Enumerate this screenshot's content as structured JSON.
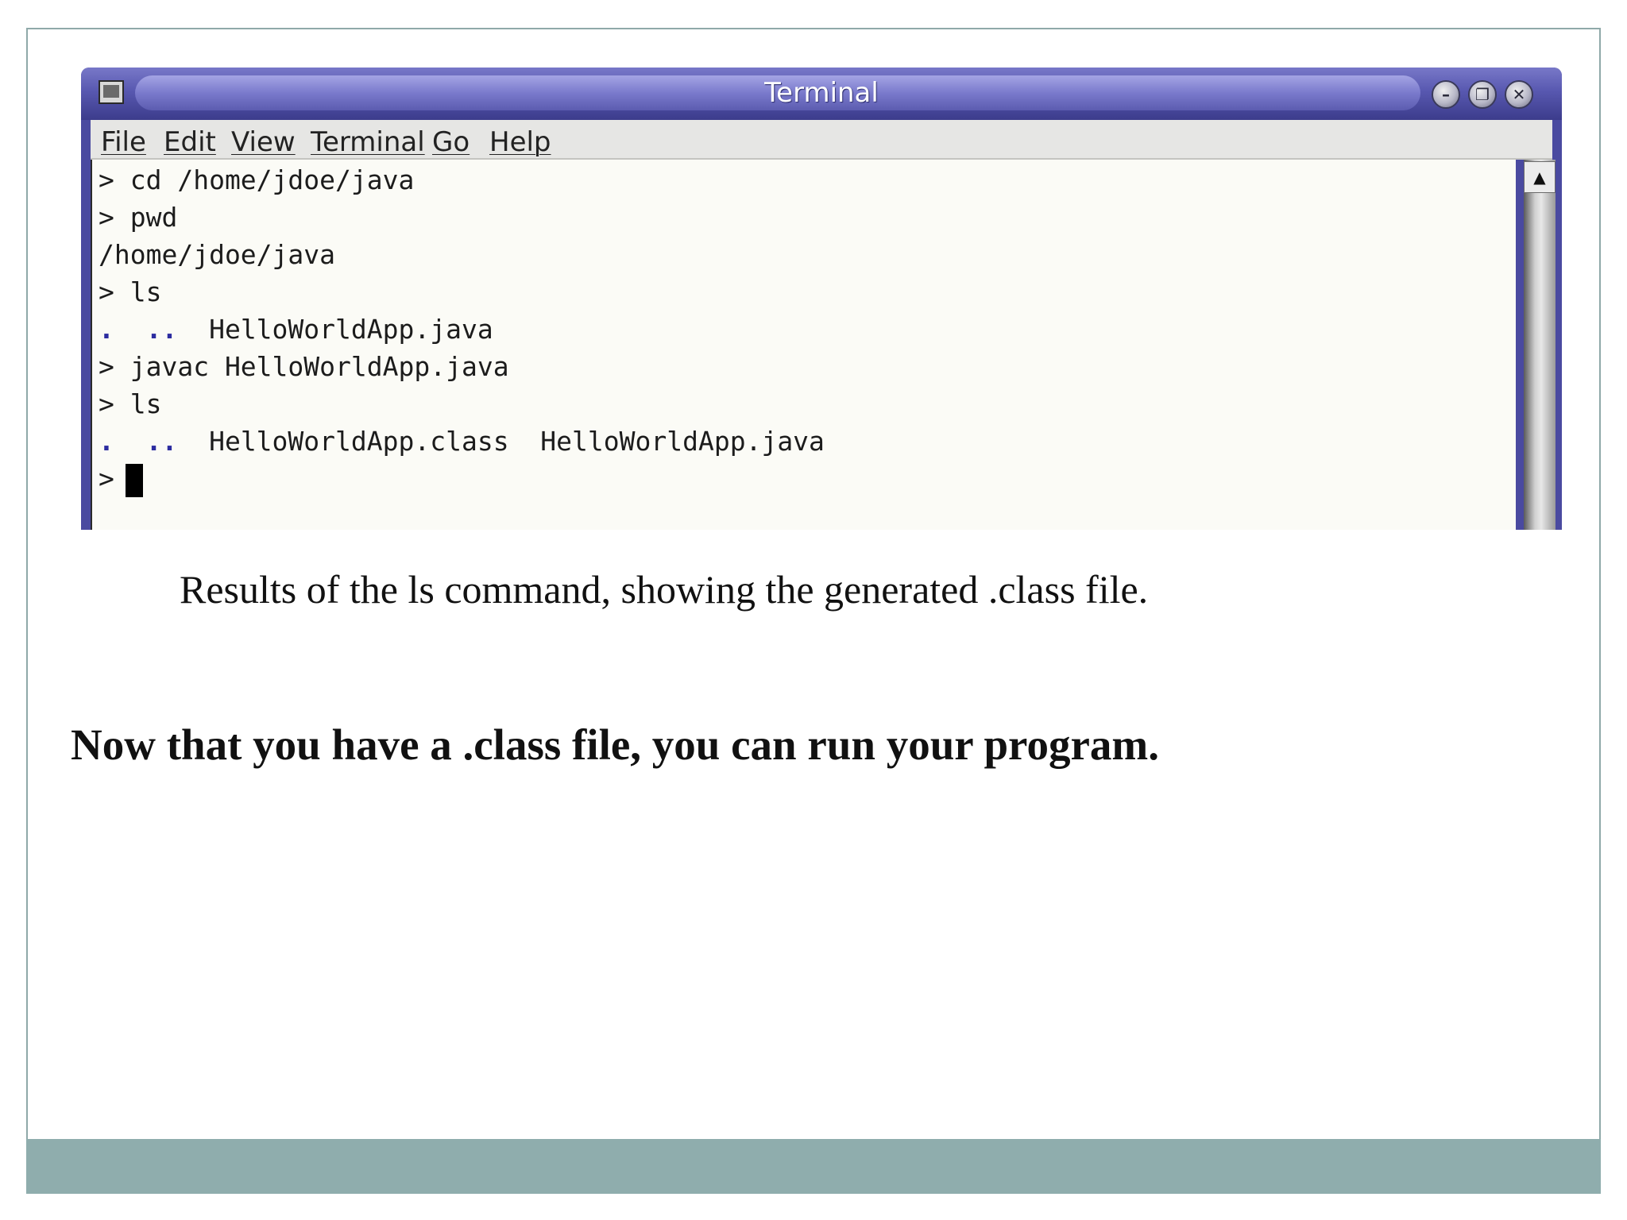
{
  "window": {
    "title": "Terminal",
    "buttons": {
      "minimize": "–",
      "maximize": "❐",
      "close": "✕"
    }
  },
  "menu": [
    "File",
    "Edit",
    "View",
    "Terminal",
    "Go",
    "Help"
  ],
  "terminal": {
    "lines": [
      {
        "text": "> cd /home/jdoe/java"
      },
      {
        "text": "> pwd"
      },
      {
        "text": "/home/jdoe/java"
      },
      {
        "text": "> ls"
      },
      {
        "dots": ".  ..",
        "text": "  HelloWorldApp.java"
      },
      {
        "text": "> javac HelloWorldApp.java"
      },
      {
        "text": "> ls"
      },
      {
        "dots": ".  ..",
        "text": "  HelloWorldApp.class  HelloWorldApp.java"
      },
      {
        "text": ">"
      }
    ],
    "scroll_up_glyph": "▲"
  },
  "caption": "Results of the ls command, showing the generated .class file.",
  "body_text": "Now that you have a .class file, you can run your program.",
  "colors": {
    "titlebar": "#5858b0",
    "terminal_bg": "#fbfbf6",
    "dir_dots": "#2c2ca0",
    "footer_band": "#8fadad",
    "frame_border": "#8fa9a9"
  },
  "icons": {
    "window_menu": "terminal-window-icon",
    "minimize": "minimize-icon",
    "maximize": "maximize-icon",
    "close": "close-icon",
    "scroll_up": "arrow-up-icon"
  }
}
